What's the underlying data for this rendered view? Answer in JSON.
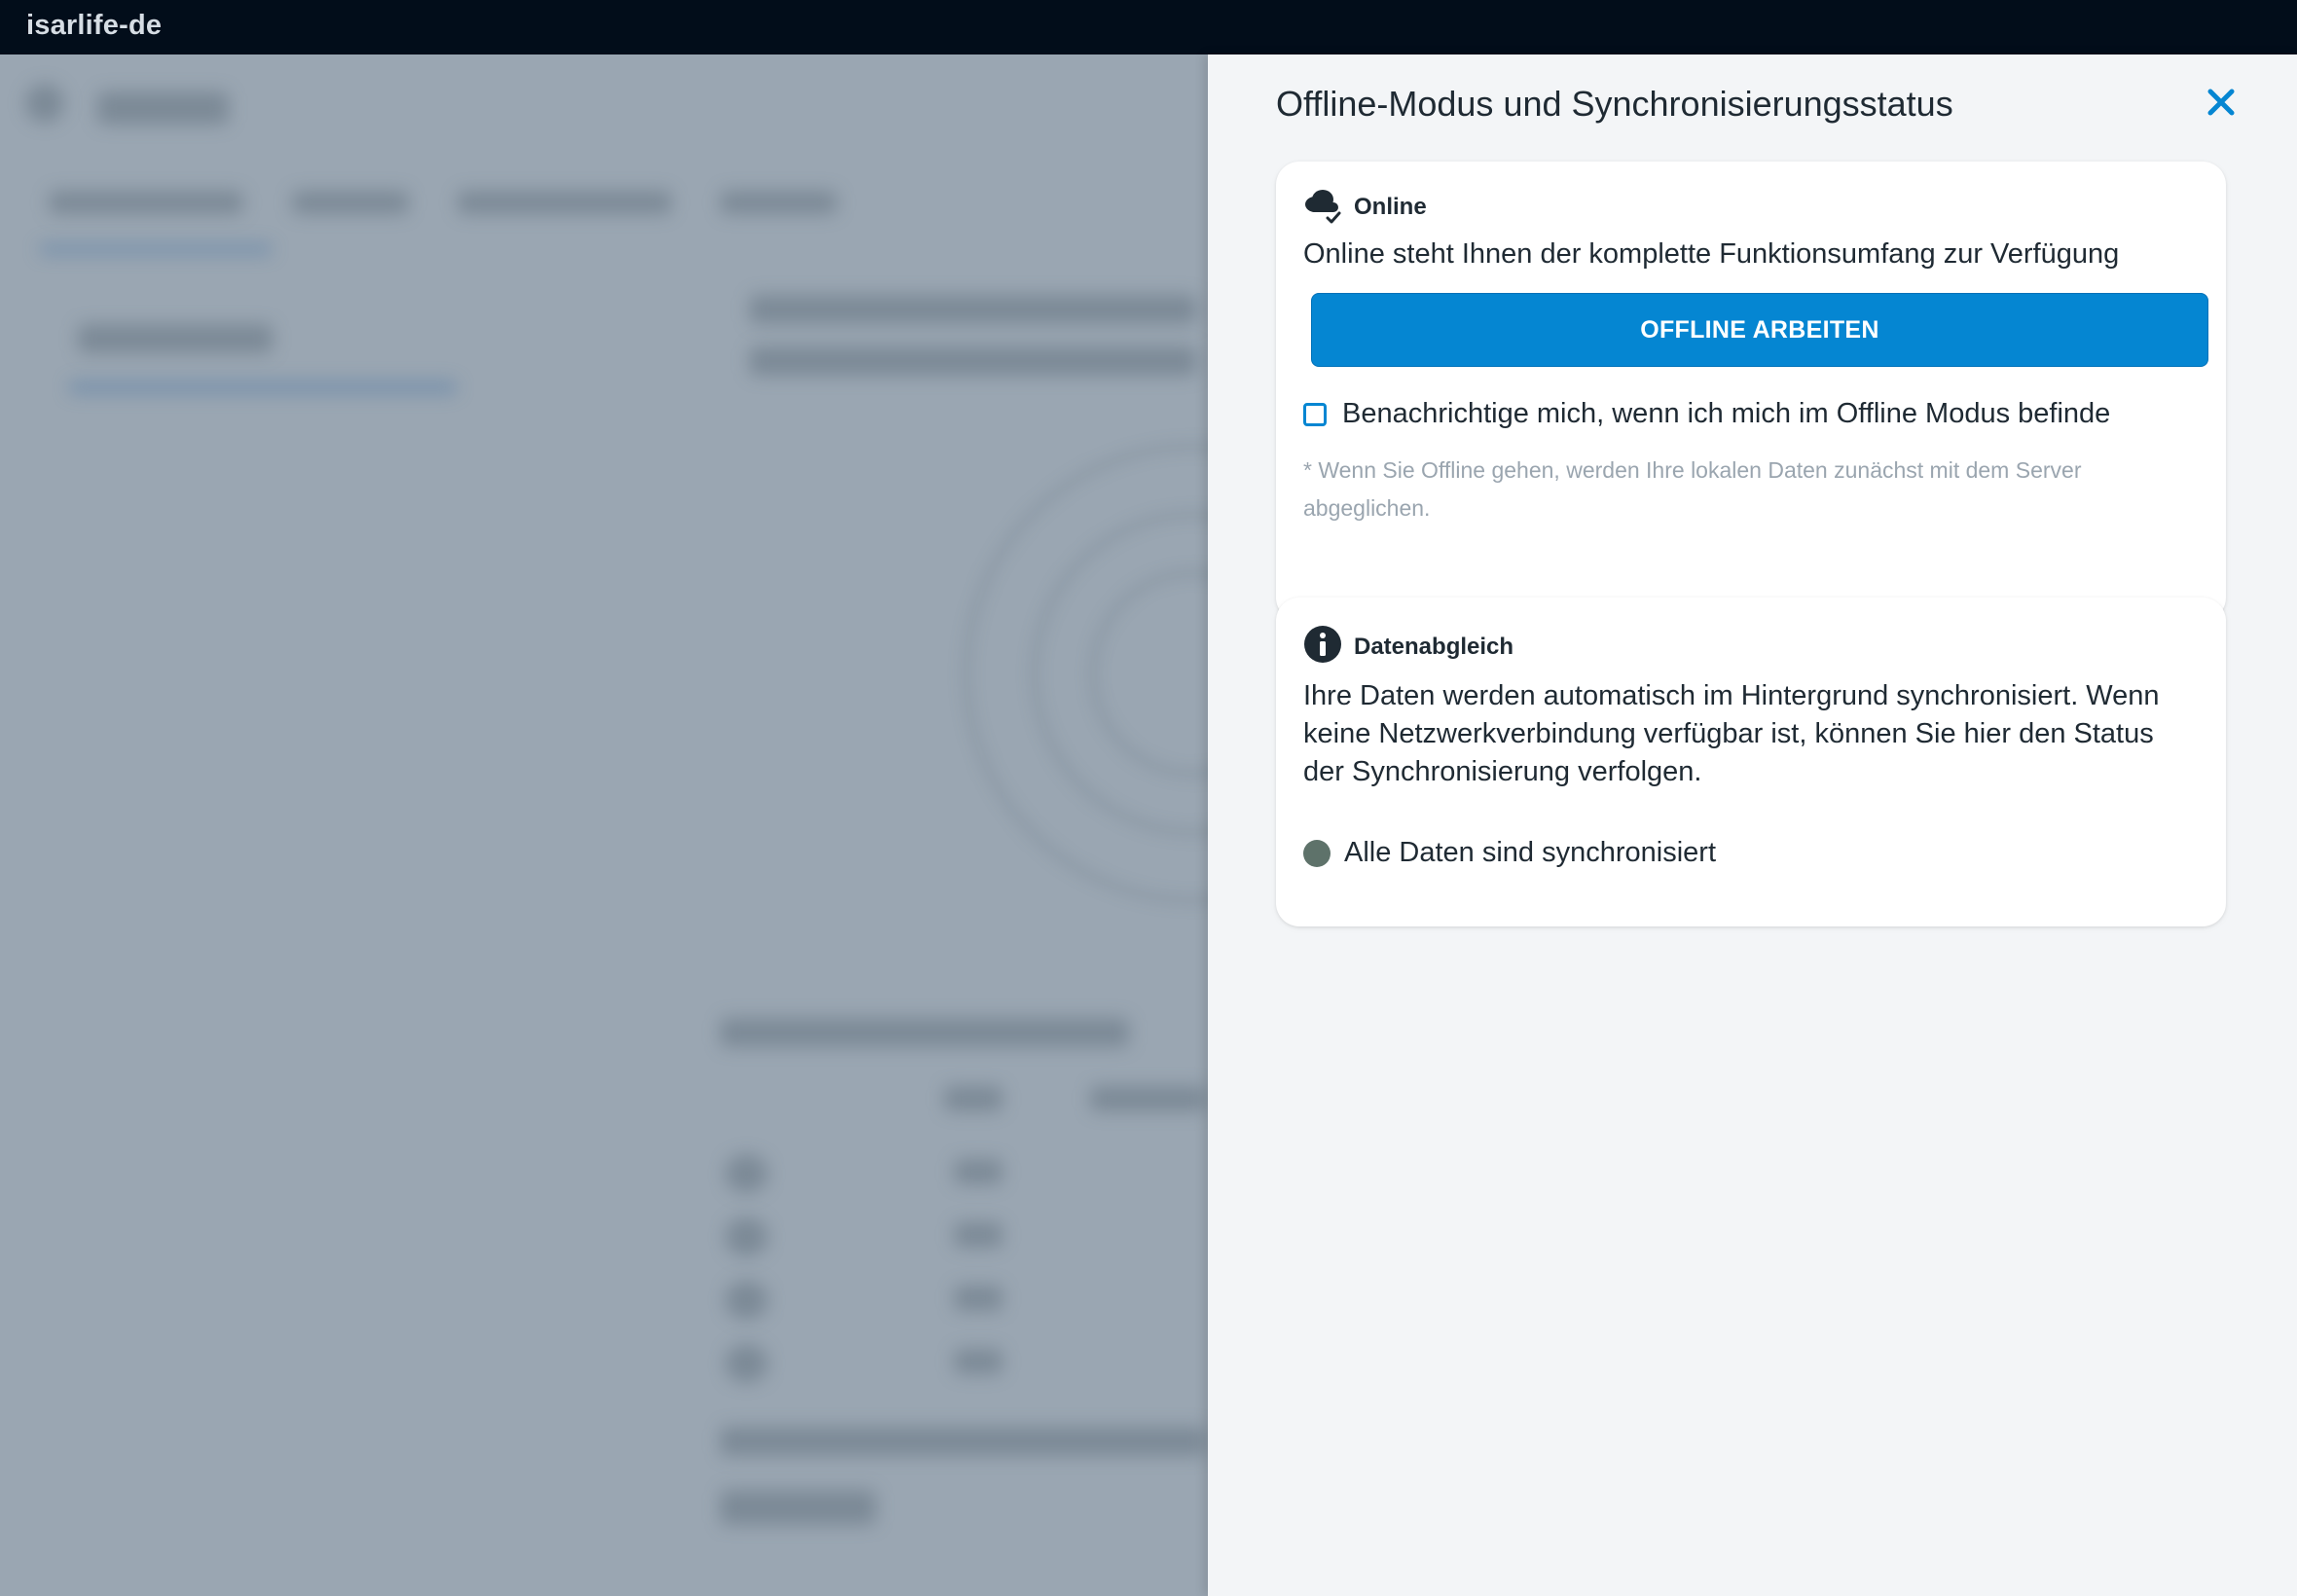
{
  "app": {
    "title": "isarlife-de"
  },
  "panel": {
    "title": "Offline-Modus und Synchronisierungsstatus",
    "close_icon": "close-icon",
    "online_card": {
      "icon": "cloud-check-icon",
      "heading": "Online",
      "description": "Online steht Ihnen der komplette Funktionsumfang zur Verfügung",
      "button_label": "OFFLINE ARBEITEN",
      "notify_checkbox": {
        "label": "Benachrichtige mich, wenn ich mich im Offline Modus befinde",
        "checked": false
      },
      "note": "* Wenn Sie Offline gehen, werden Ihre lokalen Daten zunächst mit dem Server abgeglichen."
    },
    "sync_card": {
      "icon": "info-icon",
      "heading": "Datenabgleich",
      "description": "Ihre Daten werden automatisch im Hintergrund synchronisiert. Wenn keine Netzwerkverbindung verfügbar ist, können Sie hier den Status der Synchronisierung verfolgen.",
      "status": {
        "label": "Alle Daten sind synchronisiert",
        "color": "#5e726a"
      }
    }
  },
  "colors": {
    "accent": "#0586d2",
    "topbar": "#020d1a",
    "backdrop": "#9aa6b2",
    "panel_bg": "#f3f5f7"
  }
}
